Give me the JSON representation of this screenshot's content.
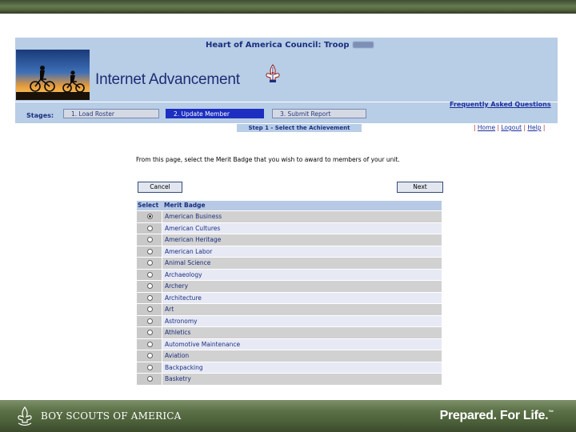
{
  "slide": {
    "org_name": "BOY SCOUTS OF AMERICA",
    "slogan": "Prepared. For Life.",
    "slogan_mark": "™"
  },
  "app": {
    "council_title": "Heart of America Council: Troop",
    "title": "Internet Advancement",
    "faq_label": "Frequently Asked Questions",
    "stages_label": "Stages:",
    "stages": [
      {
        "label": "1. Load Roster",
        "active": false
      },
      {
        "label": "2. Update Member",
        "active": true
      },
      {
        "label": "3. Submit Report",
        "active": false
      }
    ],
    "step_label": "Step 1 - Select the Achievement",
    "links": {
      "home": "Home",
      "logout": "Logout",
      "help": "Help"
    },
    "instructions": "From this page, select the Merit Badge that you wish to award to members of your unit.",
    "cancel_label": "Cancel",
    "next_label": "Next"
  },
  "table": {
    "headers": {
      "select": "Select",
      "badge": "Merit Badge"
    },
    "rows": [
      {
        "name": "American Business",
        "selected": true
      },
      {
        "name": "American Cultures",
        "selected": false
      },
      {
        "name": "American Heritage",
        "selected": false
      },
      {
        "name": "American Labor",
        "selected": false
      },
      {
        "name": "Animal Science",
        "selected": false
      },
      {
        "name": "Archaeology",
        "selected": false
      },
      {
        "name": "Archery",
        "selected": false
      },
      {
        "name": "Architecture",
        "selected": false
      },
      {
        "name": "Art",
        "selected": false
      },
      {
        "name": "Astronomy",
        "selected": false
      },
      {
        "name": "Athletics",
        "selected": false
      },
      {
        "name": "Automotive Maintenance",
        "selected": false
      },
      {
        "name": "Aviation",
        "selected": false
      },
      {
        "name": "Backpacking",
        "selected": false
      },
      {
        "name": "Basketry",
        "selected": false
      }
    ]
  },
  "colors": {
    "header_bg": "#b8cde6",
    "title_blue": "#1c2d74",
    "active_stage": "#1d2fc0",
    "link_red": "#b02020"
  }
}
